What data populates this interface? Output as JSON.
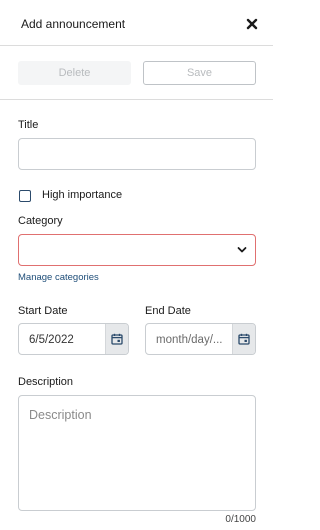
{
  "header": {
    "title": "Add announcement",
    "close_icon": "close-icon"
  },
  "actions": {
    "delete_label": "Delete",
    "save_label": "Save"
  },
  "form": {
    "title_label": "Title",
    "title_value": "",
    "high_importance_label": "High importance",
    "high_importance_checked": false,
    "category_label": "Category",
    "category_value": "",
    "manage_categories_link": "Manage categories",
    "start_date_label": "Start Date",
    "start_date_value": "6/5/2022",
    "end_date_label": "End Date",
    "end_date_placeholder": "month/day/...",
    "description_label": "Description",
    "description_placeholder": "Description",
    "char_counter": "0/1000"
  },
  "colors": {
    "error_border": "#e07070",
    "link": "#1f4e79",
    "checkbox_border": "#2b4a6b",
    "calendar_icon": "#2b4a6b"
  }
}
